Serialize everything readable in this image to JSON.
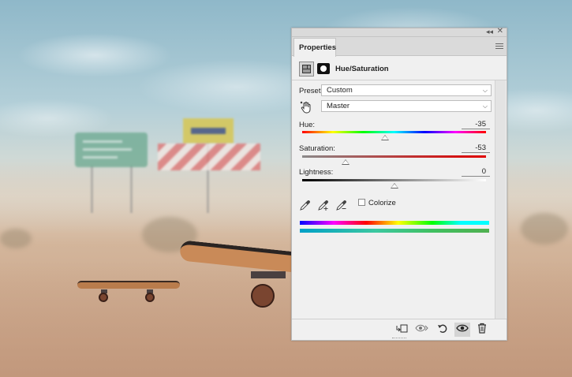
{
  "panel": {
    "tab_label": "Properties",
    "collapse_glyph": "◂◂",
    "close_glyph": "✕",
    "adjustment_title": "Hue/Saturation",
    "preset_label": "Preset:",
    "preset_value": "Custom",
    "channel_value": "Master",
    "hue": {
      "label": "Hue:",
      "value": "-35",
      "level": 0.451
    },
    "saturation": {
      "label": "Saturation:",
      "value": "-53",
      "level": 0.235
    },
    "lightness": {
      "label": "Lightness:",
      "value": "0",
      "level": 0.5
    },
    "colorize_label": "Colorize",
    "colorize_checked": false
  },
  "icons": {
    "adjustment": "adjustment-layer-icon",
    "mask": "mask-icon",
    "hand": "targeted-adjustment-hand-icon",
    "eyedroppers": [
      "eyedropper-icon",
      "eyedropper-plus-icon",
      "eyedropper-minus-icon"
    ],
    "footer": [
      "clip-to-layer-icon",
      "view-previous-state-icon",
      "reset-icon",
      "visibility-eye-icon",
      "trash-icon"
    ]
  },
  "colors": {
    "panel_bg": "#f0f0f0",
    "accent_spectrum": [
      "#ff0000",
      "#ffff00",
      "#00ff00",
      "#00ffff",
      "#0000ff",
      "#ff00ff",
      "#ff0000"
    ]
  }
}
